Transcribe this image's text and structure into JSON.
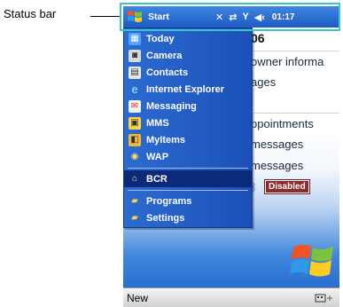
{
  "annotation": {
    "label": "Status bar"
  },
  "status_bar": {
    "start_label": "Start",
    "clock": "01:17",
    "icons": [
      "connectivity-icon",
      "sync-icon",
      "signal-icon",
      "volume-icon"
    ]
  },
  "start_menu": {
    "items": [
      {
        "label": "Today",
        "icon": "today-icon"
      },
      {
        "label": "Camera",
        "icon": "camera-icon"
      },
      {
        "label": "Contacts",
        "icon": "contacts-icon"
      },
      {
        "label": "Internet Explorer",
        "icon": "internet-explorer-icon"
      },
      {
        "label": "Messaging",
        "icon": "messaging-icon"
      },
      {
        "label": "MMS",
        "icon": "mms-icon"
      },
      {
        "label": "MyItems",
        "icon": "myitems-icon"
      },
      {
        "label": "WAP",
        "icon": "wap-icon"
      },
      {
        "label": "BCR",
        "icon": "bcr-icon",
        "selected": true
      },
      {
        "label": "Programs",
        "icon": "programs-folder-icon"
      },
      {
        "label": "Settings",
        "icon": "settings-folder-icon"
      }
    ]
  },
  "today": {
    "date": "06",
    "owner": "owner informa",
    "messages": "ages",
    "appointments": "ppointments",
    "mail1": "messages",
    "mail2": "messages",
    "bluetooth_status": "Disabled"
  },
  "softkeys": {
    "left": "New"
  },
  "colors": {
    "status_bar_highlight": "#38c6c6",
    "menu_blue": "#1b50b8",
    "selected_item": "#0b2a7a",
    "disabled_badge": "#8c2b2b"
  }
}
